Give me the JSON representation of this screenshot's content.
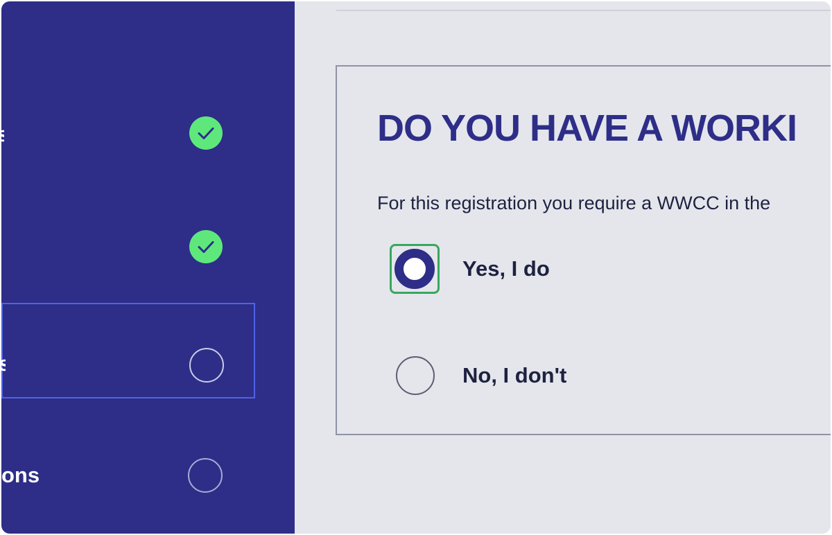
{
  "sidebar": {
    "steps": [
      {
        "label": "s",
        "status": "complete",
        "icon": "check-circle-icon"
      },
      {
        "label": "",
        "status": "complete",
        "icon": "check-circle-icon"
      },
      {
        "label": "s",
        "status": "current",
        "icon": "empty-circle-icon"
      },
      {
        "label": "ons",
        "status": "pending",
        "icon": "empty-circle-icon"
      }
    ]
  },
  "main": {
    "heading": "DO YOU HAVE A WORKI",
    "intro": "For this registration you require a WWCC in the",
    "options": [
      {
        "label": "Yes, I do",
        "selected": true
      },
      {
        "label": "No, I don't",
        "selected": false
      }
    ]
  },
  "colors": {
    "sidebar_bg": "#2e2e88",
    "check_green": "#5ee87c",
    "focus_green": "#3aa65e",
    "accent_blue": "#4f63e6",
    "content_bg": "#e4e6ec"
  }
}
